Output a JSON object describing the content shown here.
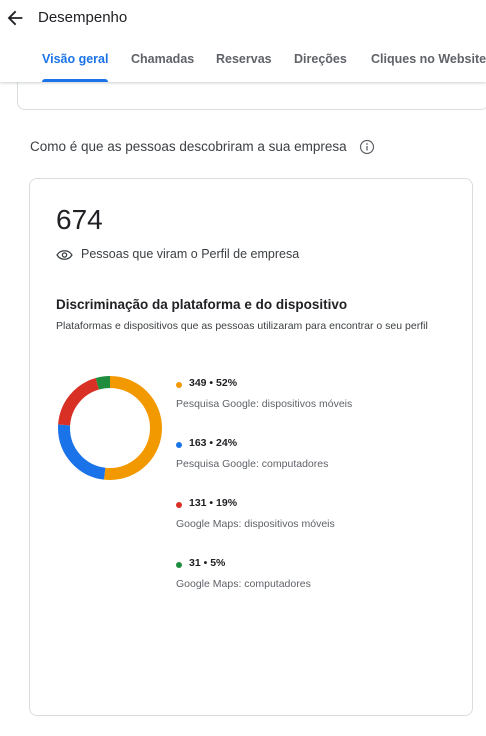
{
  "header": {
    "title": "Desempenho"
  },
  "tabs": [
    {
      "label": "Visão geral",
      "active": true
    },
    {
      "label": "Chamadas",
      "active": false
    },
    {
      "label": "Reservas",
      "active": false
    },
    {
      "label": "Direções",
      "active": false
    },
    {
      "label": "Cliques no Website",
      "active": false
    }
  ],
  "section": {
    "title": "Como é que as pessoas descobriram a sua empresa"
  },
  "summary": {
    "total": "674",
    "label": "Pessoas que viram o Perfil de empresa"
  },
  "breakdown": {
    "title": "Discriminação da plataforma e do dispositivo",
    "subtitle": "Plataformas e dispositivos que as pessoas utilizaram para encontrar o seu perfil"
  },
  "colors": {
    "accent": "#1a73e8",
    "orange": "#f29900",
    "blue": "#1a73e8",
    "red": "#d93025",
    "green": "#1e8e3e"
  },
  "chart_data": {
    "type": "pie",
    "donut": true,
    "total": 674,
    "series": [
      {
        "name": "Pesquisa Google: dispositivos móveis",
        "value": 349,
        "percent": 52,
        "display": "349 • 52%",
        "color": "#f29900"
      },
      {
        "name": "Pesquisa Google: computadores",
        "value": 163,
        "percent": 24,
        "display": "163 • 24%",
        "color": "#1a73e8"
      },
      {
        "name": "Google Maps: dispositivos móveis",
        "value": 131,
        "percent": 19,
        "display": "131 • 19%",
        "color": "#d93025"
      },
      {
        "name": "Google Maps: computadores",
        "value": 31,
        "percent": 5,
        "display": "31 • 5%",
        "color": "#1e8e3e"
      }
    ]
  }
}
